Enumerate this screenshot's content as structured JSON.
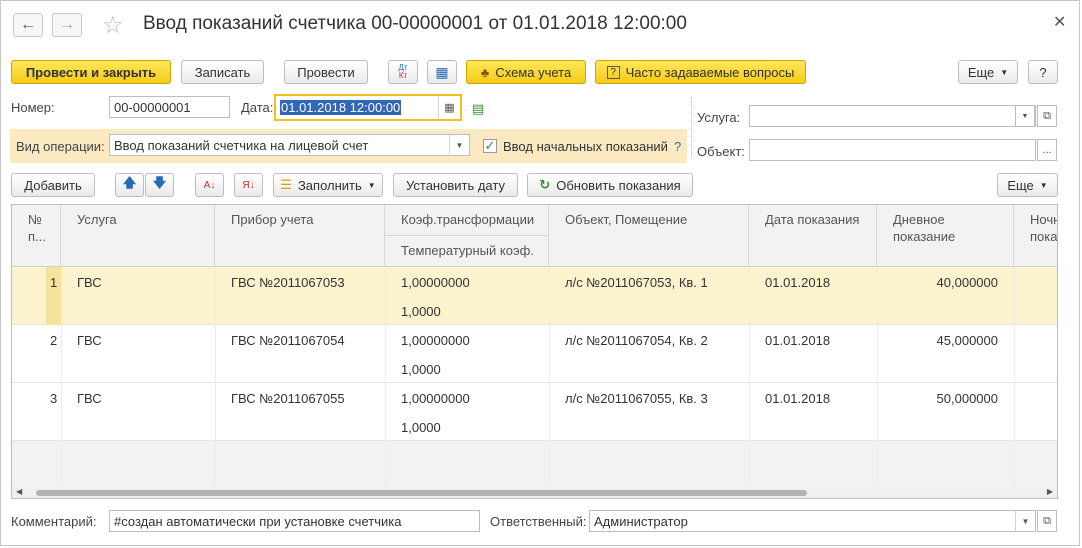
{
  "window": {
    "title": "Ввод показаний счетчика 00-00000001 от 01.01.2018 12:00:00"
  },
  "toolbar": {
    "post_close": "Провести и закрыть",
    "save": "Записать",
    "post": "Провести",
    "dtkt_top": "Дт",
    "dtkt_bottom": "Кт",
    "scheme": "Схема учета",
    "faq": "Часто задаваемые вопросы",
    "more": "Еще",
    "help": "?"
  },
  "form": {
    "number_label": "Номер:",
    "number_value": "00-00000001",
    "date_label": "Дата:",
    "date_value": "01.01.2018 12:00:00",
    "operation_label": "Вид операции:",
    "operation_value": "Ввод показаний счетчика на лицевой счет",
    "initial_label": "Ввод начальных показаний",
    "initial_help": "?",
    "service_label": "Услуга:",
    "service_value": "",
    "object_label": "Объект:",
    "object_value": "",
    "ellipsis": "..."
  },
  "table_toolbar": {
    "add": "Добавить",
    "fill": "Заполнить",
    "set_date": "Установить дату",
    "refresh": "Обновить показания",
    "more": "Еще"
  },
  "table": {
    "headers": {
      "num": "№ п...",
      "service": "Услуга",
      "device": "Прибор учета",
      "coef": "Коэф.трансформации",
      "temp": "Температурный коэф.",
      "object": "Объект, Помещение",
      "date": "Дата показания",
      "day": "Дневное показание",
      "night": "Ночн... пока..."
    },
    "rows": [
      {
        "num": "1",
        "service": "ГВС",
        "device": "ГВС №2011067053",
        "coef": "1,00000000",
        "temp": "1,0000",
        "object": "л/с №2011067053, Кв. 1",
        "date": "01.01.2018",
        "day": "40,000000"
      },
      {
        "num": "2",
        "service": "ГВС",
        "device": "ГВС №2011067054",
        "coef": "1,00000000",
        "temp": "1,0000",
        "object": "л/с №2011067054, Кв. 2",
        "date": "01.01.2018",
        "day": "45,000000"
      },
      {
        "num": "3",
        "service": "ГВС",
        "device": "ГВС №2011067055",
        "coef": "1,00000000",
        "temp": "1,0000",
        "object": "л/с №2011067055, Кв. 3",
        "date": "01.01.2018",
        "day": "50,000000"
      }
    ]
  },
  "footer": {
    "comment_label": "Комментарий:",
    "comment_value": "#создан автоматически при установке счетчика",
    "responsible_label": "Ответственный:",
    "responsible_value": "Администратор"
  },
  "colors": {
    "accent_yellow": "#f5cc16",
    "current_row": "#fbf3cd",
    "operation_band": "#fbe9c2",
    "selection": "#3166b8"
  }
}
